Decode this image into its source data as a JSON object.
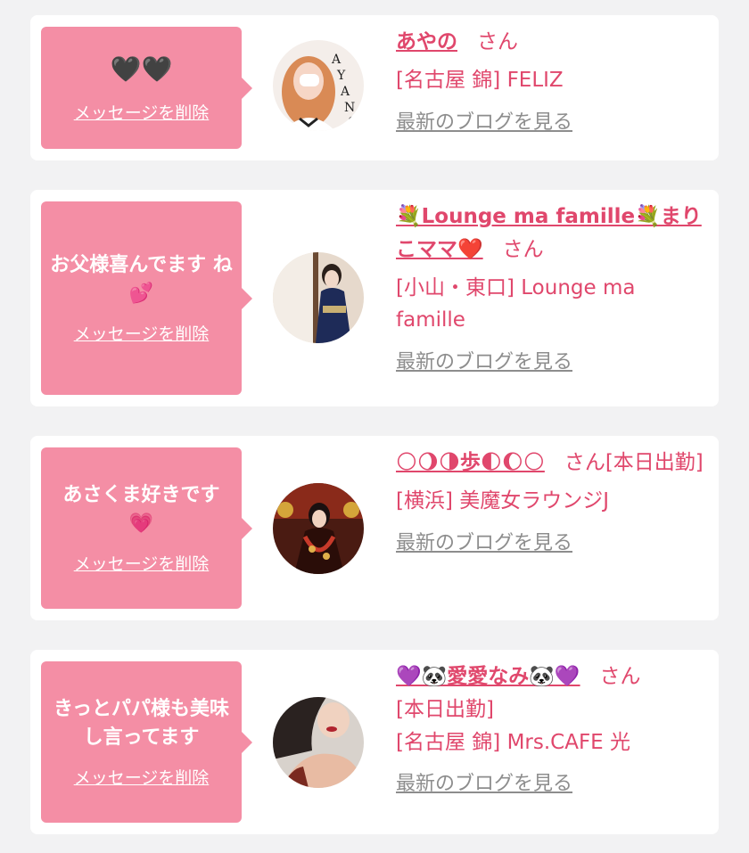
{
  "cards": [
    {
      "message": "🖤🖤",
      "delete_label": "メッセージを削除",
      "name": "あやの",
      "honorific": "さん",
      "shop": "[名古屋 錦] FELIZ",
      "blog_link": "最新のブログを見る",
      "avatar_caption": "AYANO"
    },
    {
      "message": "お父様喜んでます ね💕",
      "delete_label": "メッセージを削除",
      "name": "💐Lounge ma famille💐まりこママ❤️",
      "honorific": "さん",
      "shop": "[小山・東口] Lounge ma famille",
      "blog_link": "最新のブログを見る"
    },
    {
      "message": "あさくま好きです 💗",
      "delete_label": "メッセージを削除",
      "name": "🌕🌖🌗歩🌓🌔🌕",
      "honorific": "さん[本日出勤]",
      "shop": "[横浜] 美魔女ラウンジJ",
      "blog_link": "最新のブログを見る"
    },
    {
      "message": "きっとパパ様も美味し言ってます",
      "delete_label": "メッセージを削除",
      "name": "💜🐼愛愛なみ🐼💜",
      "honorific": "さん",
      "status": "[本日出勤]",
      "shop": "[名古屋 錦] Mrs.CAFE 光",
      "blog_link": "最新のブログを見る"
    }
  ],
  "colors": {
    "accent": "#e0476c",
    "bubble": "#f48ea5",
    "link_gray": "#8d8d8d",
    "background": "#f2f2f3"
  }
}
